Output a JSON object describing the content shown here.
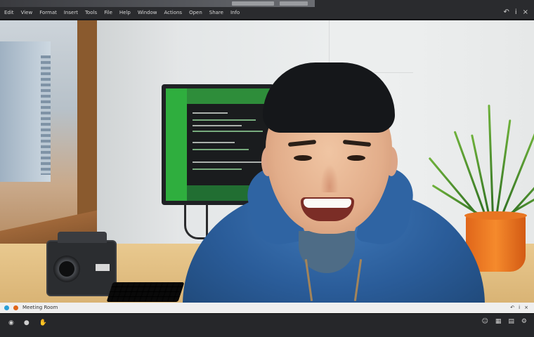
{
  "menu": {
    "items": [
      "Edit",
      "View",
      "Format",
      "Insert",
      "Tools",
      "File",
      "Help",
      "Window",
      "Actions",
      "Open",
      "Share",
      "Info"
    ]
  },
  "topright": {
    "back_icon": "↶",
    "info_icon": "i",
    "close_icon": "×"
  },
  "infobar": {
    "caption": "Meeting Room"
  },
  "controlbar": {
    "mic_icon": "◉",
    "camera_icon": "●",
    "hand_icon": "✋",
    "reactions_icon": "☺",
    "grid_icon": "▦",
    "doc_icon": "▤",
    "settings_icon": "⚙"
  },
  "colors": {
    "hoodie": "#2f64a3",
    "pot": "#f07a22",
    "monitor_green": "#2fae3e"
  }
}
